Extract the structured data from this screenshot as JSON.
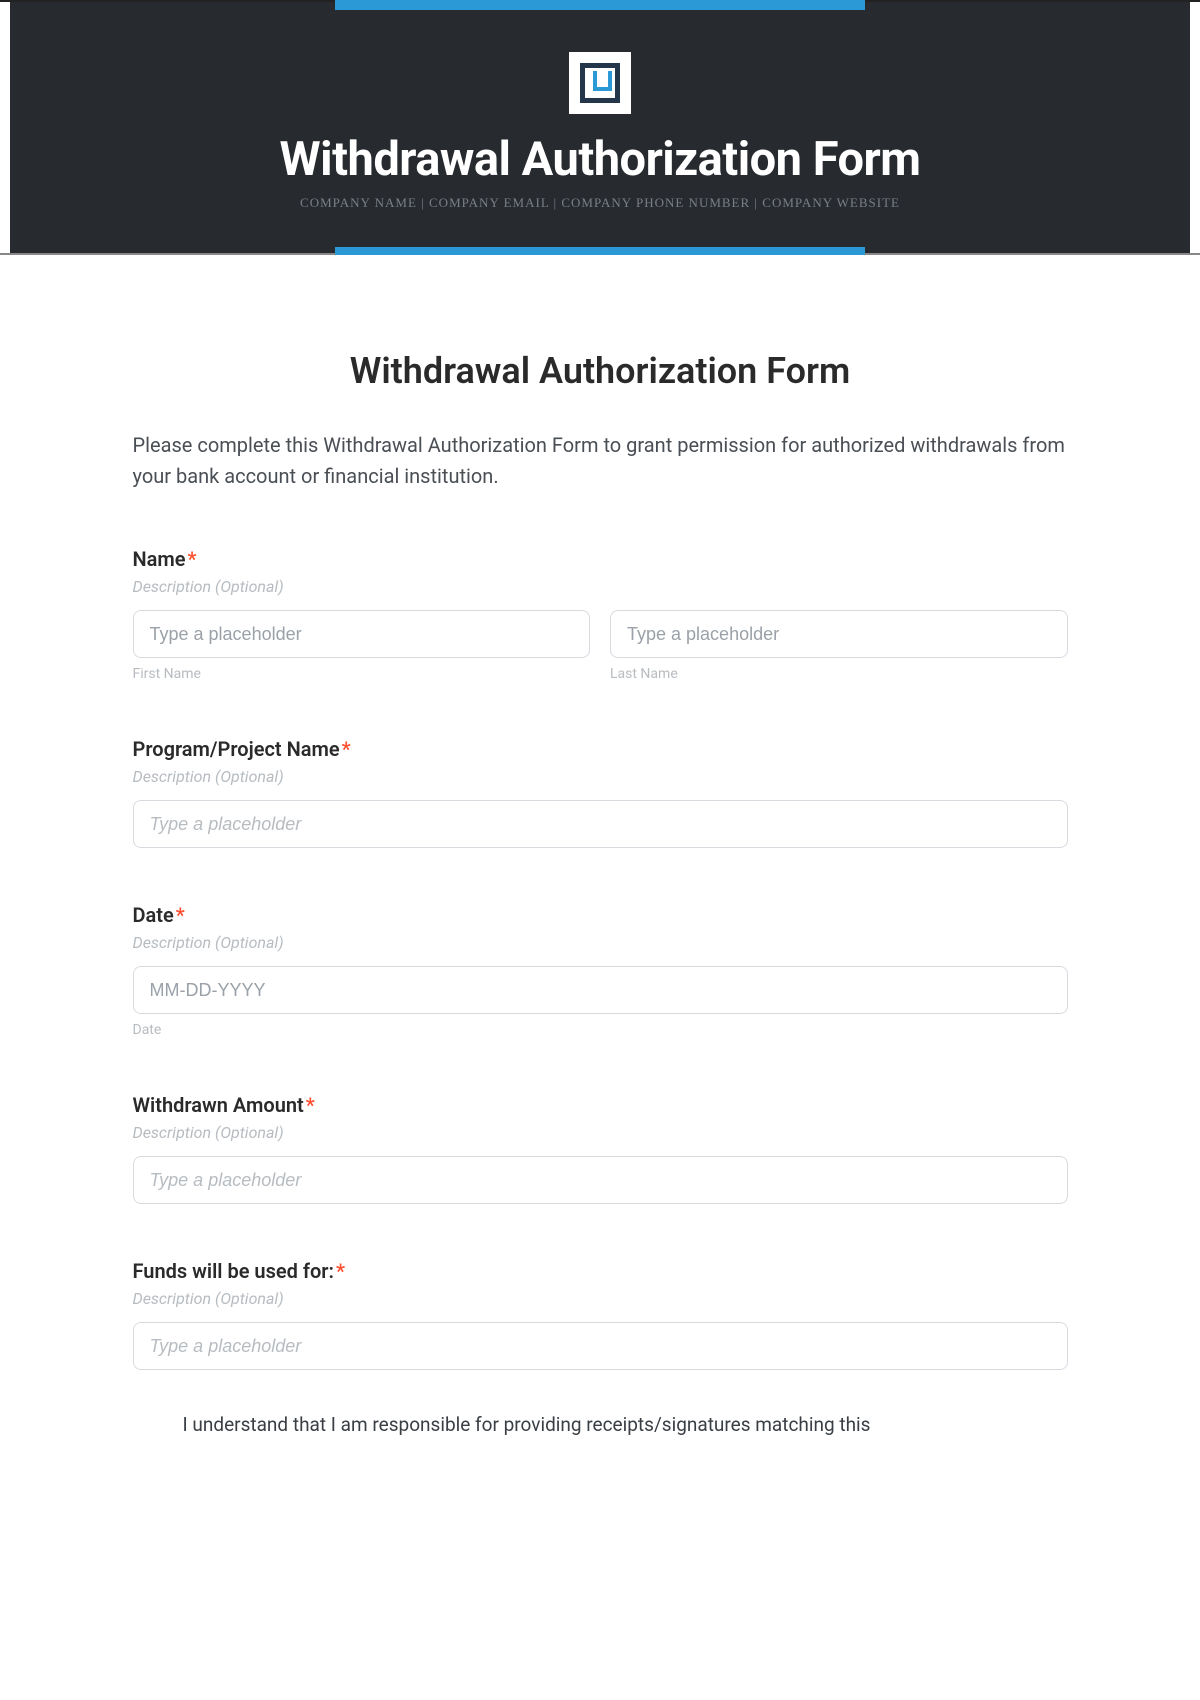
{
  "hero": {
    "title": "Withdrawal Authorization Form",
    "subtitle": "COMPANY NAME | COMPANY EMAIL | COMPANY PHONE NUMBER | COMPANY WEBSITE"
  },
  "page": {
    "heading": "Withdrawal Authorization Form",
    "intro": "Please complete this Withdrawal Authorization Form to grant permission for authorized withdrawals from your bank account or financial institution."
  },
  "fields": {
    "name": {
      "label": "Name",
      "required": "*",
      "desc": "Description (Optional)",
      "first_placeholder": "Type a placeholder",
      "first_sub": "First Name",
      "last_placeholder": "Type a placeholder",
      "last_sub": "Last Name"
    },
    "program": {
      "label": "Program/Project Name",
      "required": "*",
      "desc": "Description (Optional)",
      "placeholder": "Type a placeholder"
    },
    "date": {
      "label": "Date",
      "required": "*",
      "desc": "Description (Optional)",
      "placeholder": "MM-DD-YYYY",
      "sub": "Date"
    },
    "amount": {
      "label": "Withdrawn Amount",
      "required": "*",
      "desc": "Description (Optional)",
      "placeholder": "Type a placeholder"
    },
    "usedfor": {
      "label": "Funds will be used for:",
      "required": "*",
      "desc": "Description (Optional)",
      "placeholder": "Type a placeholder"
    }
  },
  "disclaimer": "I understand that I am responsible for providing receipts/signatures matching this"
}
